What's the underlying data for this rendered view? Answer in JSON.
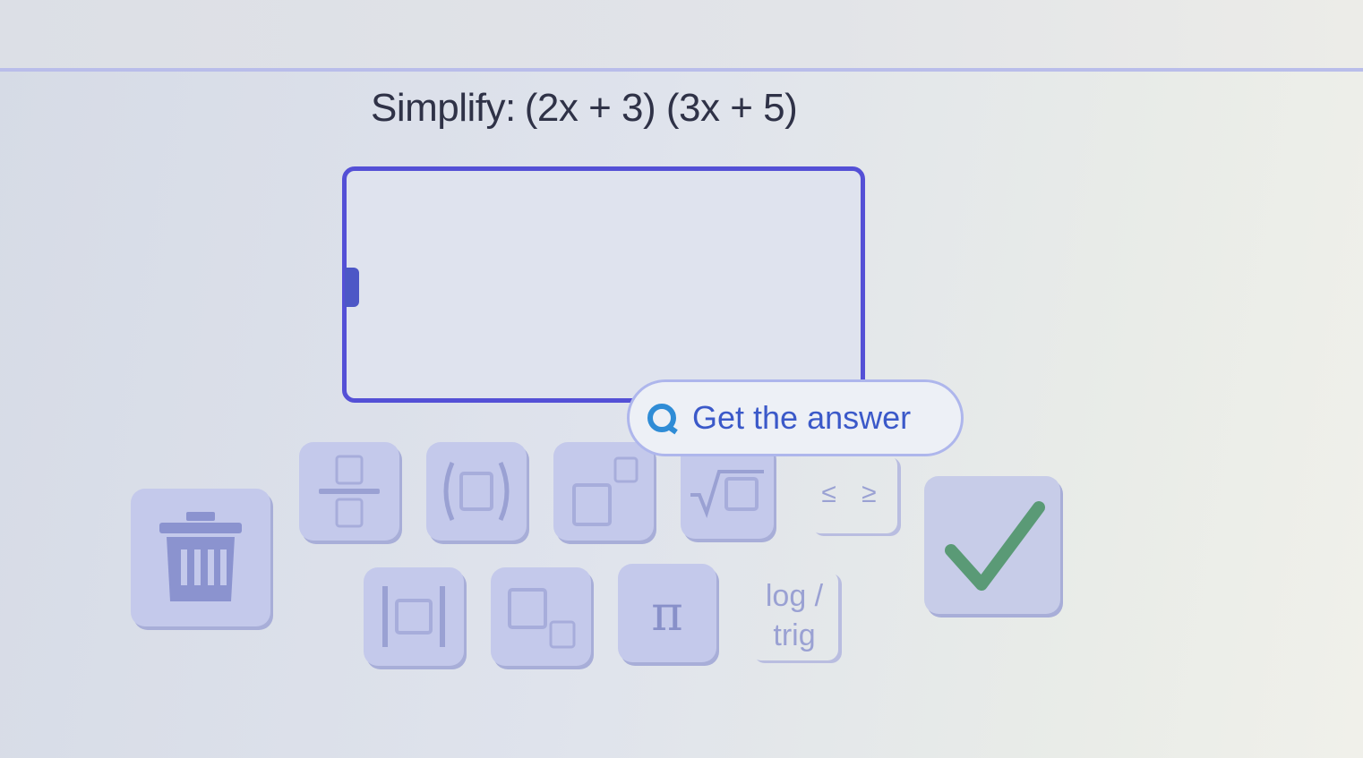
{
  "problem": {
    "label": "Simplify:",
    "expression": "(2x + 3) (3x + 5)"
  },
  "answer_input": {
    "value": ""
  },
  "get_answer": {
    "label": "Get the answer",
    "icon": "search-icon"
  },
  "keypad": {
    "delete_icon": "trash-icon",
    "fraction_icon": "fraction-icon",
    "parentheses_icon": "parentheses-icon",
    "exponent_icon": "exponent-icon",
    "sqrt_icon": "square-root-icon",
    "inequalities_label": "≤ ≥",
    "abs_icon": "absolute-value-icon",
    "subscript_icon": "subscript-icon",
    "pi_label": "π",
    "logtrig_line1": "log /",
    "logtrig_line2": "trig",
    "submit_icon": "checkmark-icon"
  },
  "colors": {
    "accent": "#5450d6",
    "key_bg": "#c4c9eb",
    "check": "#5a9a76",
    "link": "#3b59c9"
  }
}
